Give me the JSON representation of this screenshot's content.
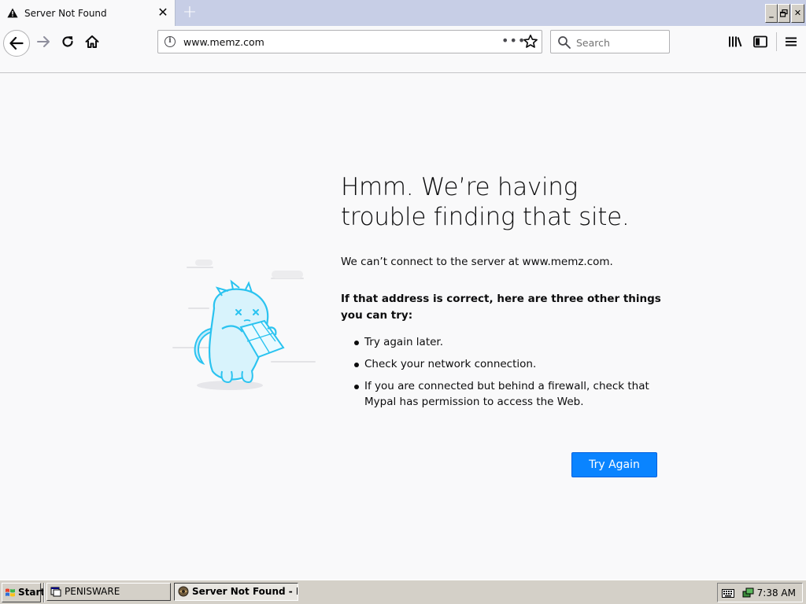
{
  "browser": {
    "tab": {
      "title": "Server Not Found",
      "close": "✕"
    },
    "new_tab": "+",
    "window_buttons": {
      "minimize": "_",
      "restore": "🗗",
      "close": "✕"
    },
    "url": "www.memz.com",
    "url_more": "•••",
    "search_placeholder": "Search"
  },
  "error_page": {
    "title": "Hmm. We’re having trouble finding that site.",
    "description": "We can’t connect to the server at www.memz.com.",
    "suggestion_heading": "If that address is correct, here are three other things you can try:",
    "suggestions": [
      "Try again later.",
      "Check your network connection.",
      "If you are connected but behind a firewall, check that Mypal has permission to access the Web."
    ],
    "button": "Try Again",
    "colors": {
      "button": "#0a84ff",
      "illustration": "#2ac3f0"
    }
  },
  "taskbar": {
    "start": "Start",
    "tasks": [
      {
        "label": "PENISWARE",
        "active": false
      },
      {
        "label": "Server Not Found - M...",
        "active": true
      }
    ],
    "clock": "7:38 AM"
  }
}
